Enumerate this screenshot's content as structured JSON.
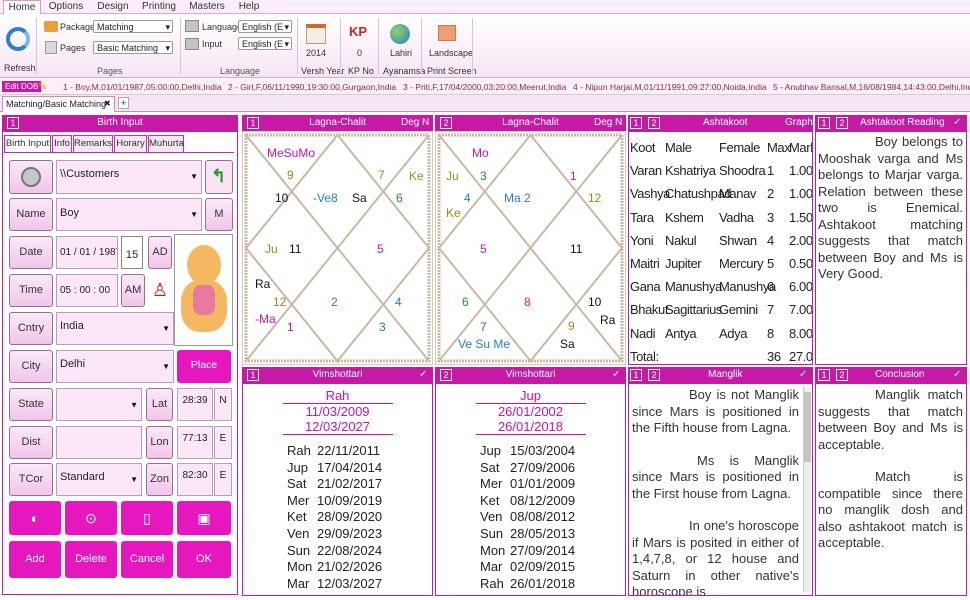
{
  "menu": {
    "home": "Home",
    "options": "Options",
    "design": "Design",
    "printing": "Printing",
    "masters": "Masters",
    "help": "Help"
  },
  "ribbon": {
    "refresh": "Refresh",
    "package_label": "Package",
    "package_value": "Matching",
    "pages_label": "Pages",
    "pages_value": "Basic Matching",
    "pages_group": "Pages",
    "language_label": "Language",
    "language_value": "English (E",
    "input_label": "Input",
    "input_value": "English (E",
    "language_group": "Language",
    "year_value": "2014",
    "year_label": "Versh Year",
    "kp_value": "0",
    "kp_label": "KP No",
    "ayanamsa_value": "Lahiri",
    "ayanamsa_label": "Ayanamsa",
    "print_value": "Landscape",
    "print_label": "Print Screen",
    "kp_icon": "KP"
  },
  "records": {
    "edit_dob": "Edit DOB",
    "items": [
      "1 - Boy,M,01/01/1987,05:00:00,Delhi,India",
      "2 - Girl,F,06/11/1990,19:30:00,Gurgaon,India",
      "3 - Priti,F,17/04/2000,03:20:00,Meerut,India",
      "4 - Nipun Harjai,M,01/11/1991,09:27:00,Noida,India",
      "5 - Anubhav Bansal,M,16/08/1984,14:43:00,Delhi,India"
    ]
  },
  "doc_tab": {
    "label": "Matching/Basic Matching",
    "close": "✖",
    "add": "+"
  },
  "birth": {
    "num": "1",
    "title": "Birth Input",
    "tabs": [
      "Birth Input",
      "Info",
      "Remarks",
      "Horary",
      "Muhurta"
    ],
    "path": "\\\\Customers",
    "name_label": "Name",
    "name_value": "Boy",
    "gender": "M",
    "date_label": "Date",
    "date_value": "01 / 01 / 1987",
    "cal": "15",
    "ad": "AD",
    "time_label": "Time",
    "time_value": "05 :  00  :  00",
    "am": "AM",
    "country_label": "Cntry",
    "country_value": "India",
    "city_label": "City",
    "city_value": "Delhi",
    "place_finder": "Place Finder",
    "state_label": "State",
    "state_value": "",
    "lat_label": "Lat",
    "lat_value": "28:39",
    "lat_dir": "N",
    "dist_label": "Dist",
    "dist_value": "",
    "lon_label": "Lon",
    "lon_value": "77:13",
    "lon_dir": "E",
    "tcor_label": "TCor",
    "tcor_value": "Standard",
    "zon_label": "Zon",
    "zon_value": "82:30",
    "zon_dir": "E",
    "add": "Add",
    "delete": "Delete",
    "cancel": "Cancel",
    "ok": "OK"
  },
  "chart1": {
    "num": "1",
    "title": "Lagna-Chalit",
    "deg": "Deg",
    "n": "N",
    "labels": [
      {
        "t": "MeSuMo",
        "c": "#c5169f"
      },
      {
        "t": "Ke",
        "c": "#9a8a1a"
      },
      {
        "t": "Ju",
        "c": "#9a8a1a"
      },
      {
        "t": "Ra",
        "c": "#111"
      },
      {
        "t": "-Ma",
        "c": "#c5169f"
      },
      {
        "t": "Sa",
        "c": "#111"
      },
      {
        "t": "9",
        "c": "#9a8a1a"
      },
      {
        "t": "10",
        "c": "#111"
      },
      {
        "t": "-Ve8",
        "c": "#2c7bc1"
      },
      {
        "t": "7",
        "c": "#9a8a1a"
      },
      {
        "t": "6",
        "c": "#2b8a2b"
      },
      {
        "t": "11",
        "c": "#111"
      },
      {
        "t": "5",
        "c": "#c5169f"
      },
      {
        "t": "12",
        "c": "#9a8a1a"
      },
      {
        "t": "2",
        "c": "#2c7bc1"
      },
      {
        "t": "4",
        "c": "#2c7bc1"
      },
      {
        "t": "1",
        "c": "#c5169f"
      },
      {
        "t": "3",
        "c": "#2b8a2b"
      }
    ]
  },
  "chart2": {
    "num": "2",
    "title": "Lagna-Chalit",
    "deg": "Deg",
    "n": "N",
    "labels": [
      {
        "t": "Mo",
        "c": "#c5169f"
      },
      {
        "t": "Ju",
        "c": "#9a8a1a"
      },
      {
        "t": "3",
        "c": "#2b8a2b"
      },
      {
        "t": "4",
        "c": "#2c7bc1"
      },
      {
        "t": "Ke",
        "c": "#9a8a1a"
      },
      {
        "t": "Ma 2",
        "c": "#2c7bc1"
      },
      {
        "t": "1",
        "c": "#c5169f"
      },
      {
        "t": "12",
        "c": "#9a8a1a"
      },
      {
        "t": "5",
        "c": "#c5169f"
      },
      {
        "t": "11",
        "c": "#111"
      },
      {
        "t": "6",
        "c": "#2b8a2b"
      },
      {
        "t": "8",
        "c": "#c5169f"
      },
      {
        "t": "10",
        "c": "#111"
      },
      {
        "t": "Ra",
        "c": "#111"
      },
      {
        "t": "7",
        "c": "#2b8a2b"
      },
      {
        "t": "9",
        "c": "#9a8a1a"
      },
      {
        "t": "Ve Su Me",
        "c": "#2c7bc1"
      },
      {
        "t": "Sa",
        "c": "#111"
      }
    ]
  },
  "ashtakoot": {
    "num1": "1",
    "num2": "2",
    "title": "Ashtakoot",
    "graph": "Graph",
    "header": [
      "Koot",
      "Male",
      "Female",
      "Max",
      "Mark"
    ],
    "rows": [
      [
        "Varan",
        "Kshatriya",
        "Shoodra",
        "1",
        "1.00"
      ],
      [
        "Vashya",
        "Chatushpad",
        "Manav",
        "2",
        "1.00"
      ],
      [
        "Tara",
        "Kshem",
        "Vadha",
        "3",
        "1.50"
      ],
      [
        "Yoni",
        "Nakul",
        "Shwan",
        "4",
        "2.00"
      ],
      [
        "Maitri",
        "Jupiter",
        "Mercury",
        "5",
        "0.50"
      ],
      [
        "Gana",
        "Manushya",
        "Manushya",
        "6",
        "6.00"
      ],
      [
        "Bhakut",
        "Sagittarius",
        "Gemini",
        "7",
        "7.00"
      ],
      [
        "Nadi",
        "Antya",
        "Adya",
        "8",
        "8.00"
      ],
      [
        "Total:",
        "",
        "",
        "36",
        "27.00"
      ]
    ]
  },
  "reading": {
    "num1": "1",
    "num2": "2",
    "title": "Ashtakoot Reading",
    "check": "✓",
    "text": "Boy belongs to Mooshak varga and Ms belongs to Marjar varga. Relation between these two is Enemical. Ashtakoot matching suggests that match between Boy and Ms is Very Good."
  },
  "vim1": {
    "num": "1",
    "title": "Vimshottari",
    "check": "✓",
    "maha": "Rah",
    "start": "11/03/2009",
    "end": "12/03/2027",
    "rows": [
      [
        "Rah",
        "22/11/2011"
      ],
      [
        "Jup",
        "17/04/2014"
      ],
      [
        "Sat",
        "21/02/2017"
      ],
      [
        "Mer",
        "10/09/2019"
      ],
      [
        "Ket",
        "28/09/2020"
      ],
      [
        "Ven",
        "29/09/2023"
      ],
      [
        "Sun",
        "22/08/2024"
      ],
      [
        "Mon",
        "21/02/2026"
      ],
      [
        "Mar",
        "12/03/2027"
      ]
    ]
  },
  "vim2": {
    "num": "2",
    "title": "Vimshottari",
    "check": "✓",
    "maha": "Jup",
    "start": "26/01/2002",
    "end": "26/01/2018",
    "rows": [
      [
        "Jup",
        "15/03/2004"
      ],
      [
        "Sat",
        "27/09/2006"
      ],
      [
        "Mer",
        "01/01/2009"
      ],
      [
        "Ket",
        "08/12/2009"
      ],
      [
        "Ven",
        "08/08/2012"
      ],
      [
        "Sun",
        "28/05/2013"
      ],
      [
        "Mon",
        "27/09/2014"
      ],
      [
        "Mar",
        "02/09/2015"
      ],
      [
        "Rah",
        "26/01/2018"
      ]
    ]
  },
  "manglik": {
    "num1": "1",
    "num2": "2",
    "title": "Manglik",
    "check": "✓",
    "p1": "Boy is not Manglik since Mars is positioned in the Fifth house from Lagna.",
    "p2": "Ms is Manglik since Mars is positioned in the First house from Lagna.",
    "p3": "In one's horoscope if Mars is posited in either of 1,4,7,8, or 12 house and Saturn in other native's horoscope is"
  },
  "conclusion": {
    "num1": "1",
    "num2": "2",
    "title": "Conclusion",
    "check": "✓",
    "p1": "Manglik match suggests that match between Boy and Ms is acceptable.",
    "p2": "Match is compatible since there no manglik dosh and also ashtakoot match is acceptable."
  }
}
